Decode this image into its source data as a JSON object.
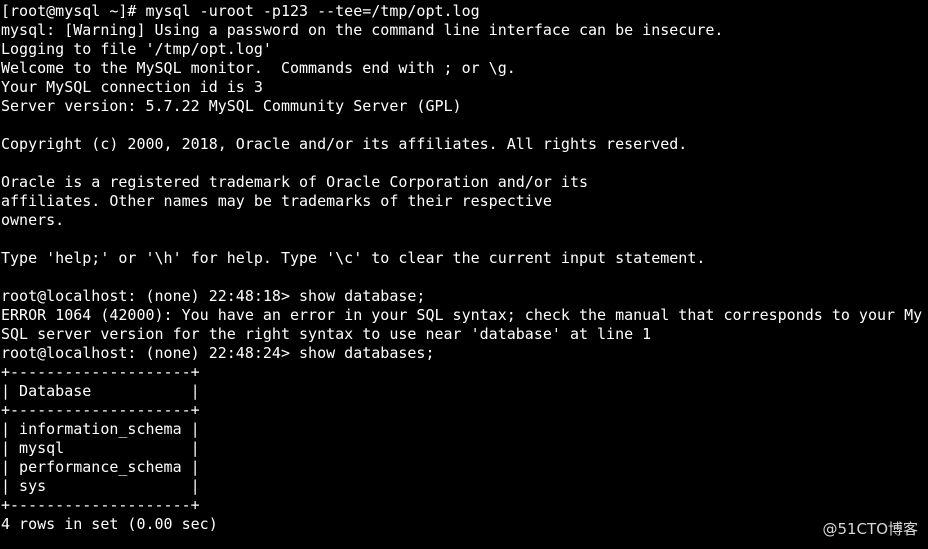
{
  "terminal": {
    "lines": [
      "[root@mysql ~]# mysql -uroot -p123 --tee=/tmp/opt.log",
      "mysql: [Warning] Using a password on the command line interface can be insecure.",
      "Logging to file '/tmp/opt.log'",
      "Welcome to the MySQL monitor.  Commands end with ; or \\g.",
      "Your MySQL connection id is 3",
      "Server version: 5.7.22 MySQL Community Server (GPL)",
      "",
      "Copyright (c) 2000, 2018, Oracle and/or its affiliates. All rights reserved.",
      "",
      "Oracle is a registered trademark of Oracle Corporation and/or its",
      "affiliates. Other names may be trademarks of their respective",
      "owners.",
      "",
      "Type 'help;' or '\\h' for help. Type '\\c' to clear the current input statement.",
      "",
      "root@localhost: (none) 22:48:18> show database;",
      "ERROR 1064 (42000): You have an error in your SQL syntax; check the manual that corresponds to your My",
      "SQL server version for the right syntax to use near 'database' at line 1",
      "root@localhost: (none) 22:48:24> show databases;",
      "+--------------------+",
      "| Database           |",
      "+--------------------+",
      "| information_schema |",
      "| mysql              |",
      "| performance_schema |",
      "| sys                |",
      "+--------------------+",
      "4 rows in set (0.00 sec)"
    ]
  },
  "watermark": {
    "text": "@51CTO博客"
  },
  "colors": {
    "background": "#000000",
    "foreground": "#ffffff"
  }
}
